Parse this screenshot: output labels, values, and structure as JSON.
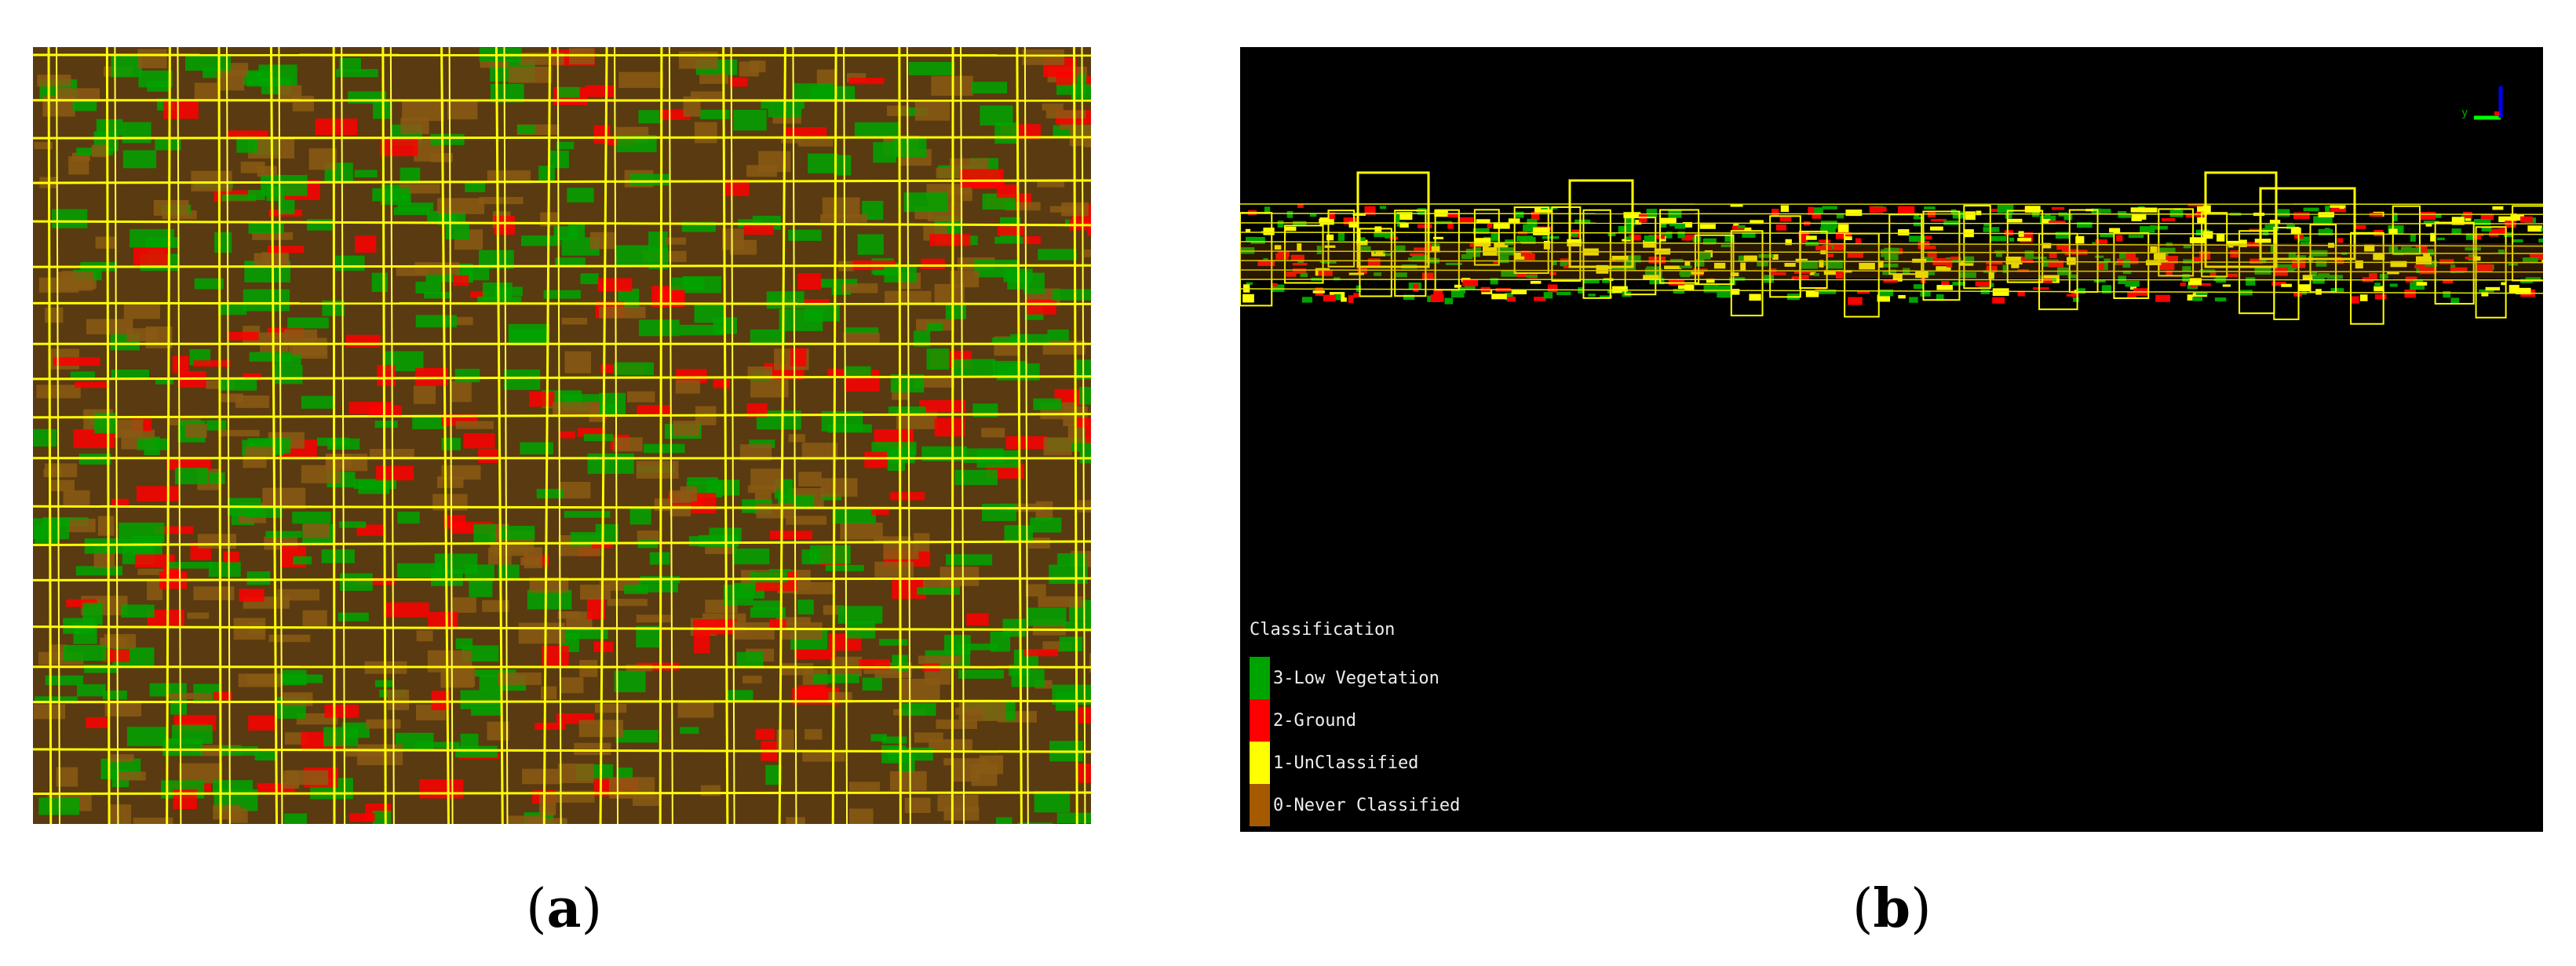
{
  "panels": [
    {
      "label_open": "(",
      "label_letter": "a",
      "label_close": ")"
    },
    {
      "label_open": "(",
      "label_letter": "b",
      "label_close": ")"
    }
  ],
  "legend": {
    "title": "Classification",
    "items": [
      {
        "label": "3-Low Vegetation",
        "color": "#00a400"
      },
      {
        "label": "2-Ground",
        "color": "#ff0000"
      },
      {
        "label": "1-UnClassified",
        "color": "#ffff00"
      },
      {
        "label": "0-Never Classified",
        "color": "#a65a00"
      }
    ]
  },
  "axis_triad": {
    "label": "y"
  }
}
